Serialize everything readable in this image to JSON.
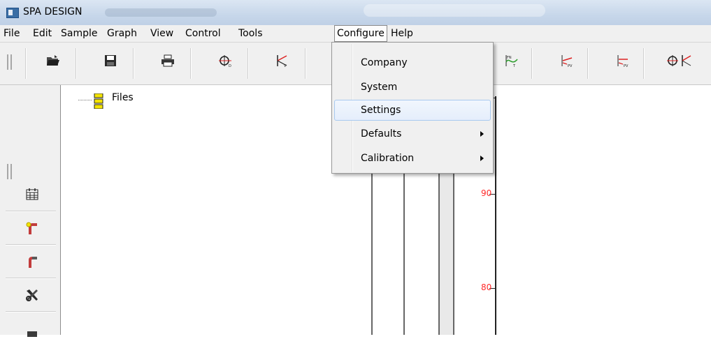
{
  "window": {
    "title": "SPA DESIGN"
  },
  "menubar": {
    "items": [
      {
        "label": "File"
      },
      {
        "label": "Edit"
      },
      {
        "label": "Sample"
      },
      {
        "label": "Graph"
      },
      {
        "label": "View"
      },
      {
        "label": "Control"
      },
      {
        "label": "Tools"
      },
      {
        "label": "Configure"
      },
      {
        "label": "Help"
      }
    ],
    "active": "Configure"
  },
  "configure_menu": {
    "items": [
      {
        "label": "Company",
        "submenu": false
      },
      {
        "label": "System",
        "submenu": false
      },
      {
        "label": "Settings",
        "submenu": false,
        "highlighted": true
      },
      {
        "label": "Defaults",
        "submenu": true
      },
      {
        "label": "Calibration",
        "submenu": true
      }
    ]
  },
  "toolbar": {
    "icons": [
      "open-folder-icon",
      "save-disk-icon",
      "print-icon",
      "graph-phi-icon",
      "graph-k-icon",
      "graph-pv-icon",
      "graph-fpv-icon",
      "graph-fpv2-icon",
      "graph-phi-k-icon"
    ]
  },
  "left_toolbar": {
    "icons": [
      "calendar-icon",
      "pipe-bend-yellow-icon",
      "pipe-bend-red-icon",
      "wrench-cross-icon"
    ]
  },
  "tree": {
    "root_label": "Files"
  },
  "graph": {
    "y_axis_labels": [
      "90",
      "80"
    ],
    "label_color": "#ff2a2a"
  },
  "colors": {
    "menu_highlight_border": "#a8c9ef",
    "axis_label": "#ff2a2a"
  }
}
